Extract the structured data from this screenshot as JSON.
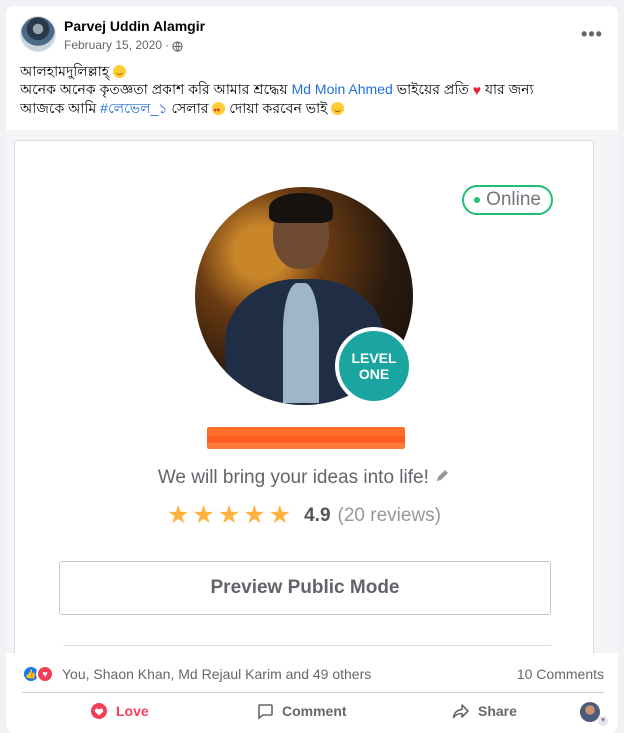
{
  "post": {
    "author": "Parvej Uddin Alamgir",
    "date": "February 15, 2020",
    "separator": "·",
    "more_icon": "more-horizontal-icon",
    "line1": "আলহামদুলিল্লাহ্",
    "line2_prefix": "অনেক অনেক কৃতজ্ঞতা প্রকাশ করি আমার শ্রদ্ধেয়",
    "mention": "Md Moin Ahmed",
    "line2_suffix": "ভাইয়ের প্রতি",
    "line2_end": "যার জন্য",
    "line3_prefix": "আজকে আমি",
    "hashtag": "#লেভেল_১",
    "line3_mid": "সেলার",
    "line3_end": "দোয়া করবেন ভাই"
  },
  "fiverr_card": {
    "online_label": "Online",
    "level_line1": "LEVEL",
    "level_line2": "ONE",
    "tagline": "We will bring your ideas into life!",
    "rating_score": "4.9",
    "rating_count": "(20 reviews)",
    "stars": 5,
    "preview_button": "Preview Public Mode",
    "accent_color": "#1dbf73",
    "star_color": "#ffb33e"
  },
  "engagement": {
    "reactions": "You, Shaon Khan, Md Rejaul Karim and 49 others",
    "comments": "10 Comments"
  },
  "actions": {
    "love": "Love",
    "comment": "Comment",
    "share": "Share"
  }
}
